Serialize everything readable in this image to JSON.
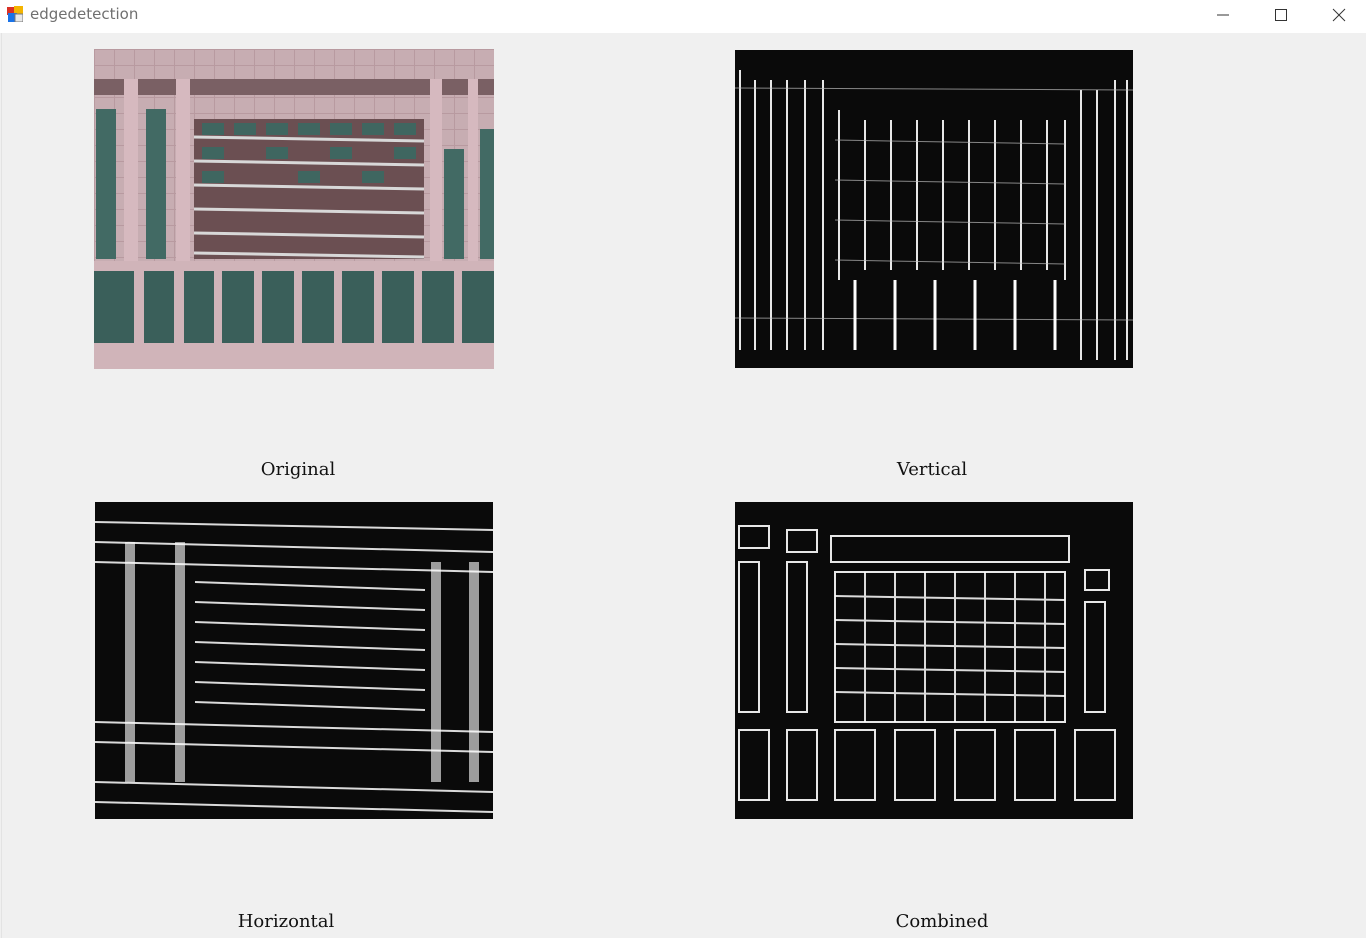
{
  "window": {
    "title": "edgedetection",
    "icon": "app-icon",
    "controls": [
      "minimize-icon",
      "maximize-icon",
      "close-icon"
    ]
  },
  "images": {
    "original": {
      "label": "Original",
      "content": "photo of building facade with windows and horizontal rails"
    },
    "vertical": {
      "label": "Vertical",
      "content": "vertical edge map"
    },
    "horizontal": {
      "label": "Horizontal",
      "content": "horizontal edge map"
    },
    "combined": {
      "label": "Combined",
      "content": "combined edge map"
    }
  },
  "colors": {
    "background": "#f0f0f0",
    "facade": "#c4a8ad",
    "glass": "#3f6660",
    "edge_bg": "#0a0a0a",
    "edge_line": "#ffffff"
  }
}
